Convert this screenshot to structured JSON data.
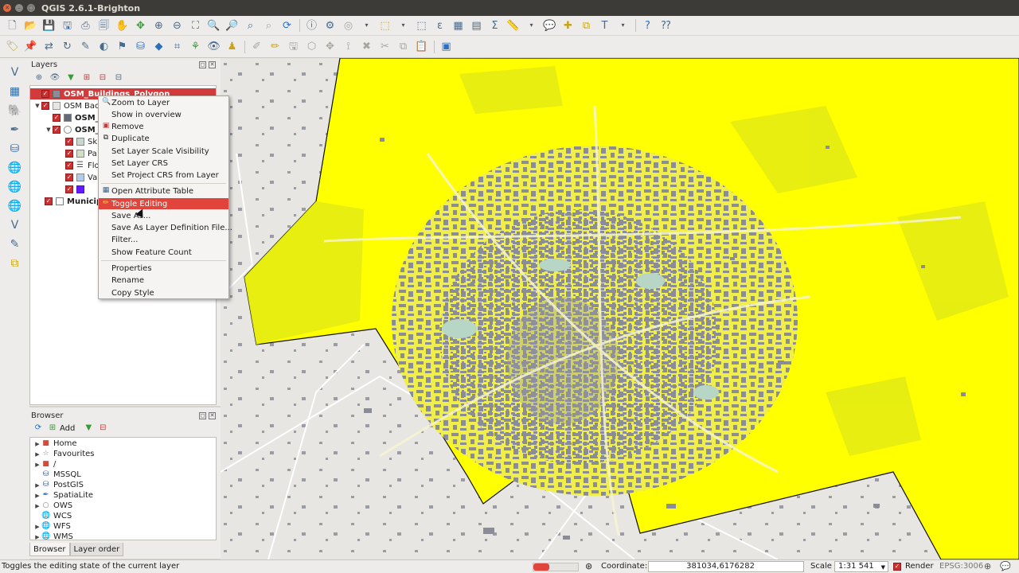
{
  "window": {
    "title": "QGIS 2.6.1-Brighton"
  },
  "toolbar_top": {
    "icons": [
      "new-project-icon",
      "open-project-icon",
      "save-project-icon",
      "save-as-icon",
      "print-composer-icon",
      "composer-manager-icon",
      "pan-icon",
      "pan-to-selection-icon",
      "zoom-in-icon",
      "zoom-out-icon",
      "zoom-full-icon",
      "zoom-to-selection-icon",
      "zoom-to-layer-icon",
      "zoom-last-icon",
      "zoom-next-icon",
      "refresh-icon",
      "identify-icon",
      "action-icon",
      "select-icon",
      "deselect-icon",
      "measure-icon",
      "field-calculator-icon",
      "attribute-table-icon",
      "statistics-icon",
      "map-tips-icon",
      "new-bookmark-icon",
      "bookmarks-icon",
      "annotation-icon",
      "text-annotation-icon",
      "help-icon",
      "whats-this-icon"
    ]
  },
  "toolbar_second": {
    "icons": [
      "label-icon",
      "pin-label-icon",
      "move-label-icon",
      "rotate-label-icon",
      "change-label-icon",
      "show-hide-labels-icon",
      "db-manager-icon",
      "georeferencer-icon",
      "csw-icon",
      "plugin-icon",
      "eye-icon",
      "python-icon",
      "edit-pencil-icon",
      "toggle-editing-icon",
      "save-edits-icon",
      "add-feature-icon",
      "move-feature-icon",
      "node-tool-icon",
      "delete-selected-icon",
      "cut-features-icon",
      "copy-features-icon",
      "paste-features-icon",
      "map-canvas-icon"
    ]
  },
  "left_toolbar": {
    "icons": [
      "add-vector-layer-icon",
      "add-raster-layer-icon",
      "add-postgis-layer-icon",
      "add-spatialite-layer-icon",
      "add-mssql-layer-icon",
      "add-wms-layer-icon",
      "add-wcs-layer-icon",
      "add-wfs-layer-icon",
      "add-delimited-text-icon",
      "new-shapefile-icon",
      "new-temp-layer-icon"
    ]
  },
  "layers_panel": {
    "title": "Layers",
    "layers": [
      {
        "label": "OSM_Buildings_Polygon",
        "checked": true,
        "selected": true
      },
      {
        "label": "OSM Bac",
        "checked": true,
        "group": true
      },
      {
        "label": "OSM_",
        "checked": true
      },
      {
        "label": "OSM_",
        "checked": true,
        "group": true
      },
      {
        "label": "Sk",
        "checked": true,
        "swatch": "#c7d9cf"
      },
      {
        "label": "Pa",
        "checked": true,
        "swatch": "#cfe0c4"
      },
      {
        "label": "Flo",
        "checked": true,
        "swatch": "#a6c5e8"
      },
      {
        "label": "Va",
        "checked": true,
        "swatch": "#b3cce9"
      },
      {
        "label": "",
        "checked": true,
        "swatch": "#6619ff"
      },
      {
        "label": "Municip",
        "checked": true,
        "unchecked_extra": true
      }
    ]
  },
  "context_menu": {
    "items": [
      {
        "label": "Zoom to Layer",
        "icon": "zoom-to-layer-icon"
      },
      {
        "label": "Show in overview",
        "icon": ""
      },
      {
        "label": "Remove",
        "icon": "remove-icon"
      },
      {
        "label": "Duplicate",
        "icon": "duplicate-icon"
      },
      {
        "label": "Set Layer Scale Visibility",
        "icon": ""
      },
      {
        "label": "Set Layer CRS",
        "icon": ""
      },
      {
        "label": "Set Project CRS from Layer",
        "icon": ""
      },
      {
        "label": "Open Attribute Table",
        "icon": "attribute-table-icon"
      },
      {
        "label": "Toggle Editing",
        "icon": "pencil-icon",
        "highlighted": true
      },
      {
        "label": "Save As...",
        "icon": ""
      },
      {
        "label": "Save As Layer Definition File...",
        "icon": ""
      },
      {
        "label": "Filter...",
        "icon": ""
      },
      {
        "label": "Show Feature Count",
        "icon": ""
      },
      {
        "label": "Properties",
        "icon": ""
      },
      {
        "label": "Rename",
        "icon": ""
      },
      {
        "label": "Copy Style",
        "icon": ""
      }
    ]
  },
  "browser_panel": {
    "title": "Browser",
    "add_label": "Add",
    "items": [
      {
        "label": "Home",
        "icon": "home-folder-icon",
        "expandable": true
      },
      {
        "label": "Favourites",
        "icon": "star-icon",
        "expandable": true
      },
      {
        "label": "/",
        "icon": "folder-icon",
        "expandable": true
      },
      {
        "label": "MSSQL",
        "icon": "mssql-icon",
        "expandable": false
      },
      {
        "label": "PostGIS",
        "icon": "postgis-icon",
        "expandable": true
      },
      {
        "label": "SpatiaLite",
        "icon": "spatialite-icon",
        "expandable": true
      },
      {
        "label": "OWS",
        "icon": "ows-icon",
        "expandable": true
      },
      {
        "label": "WCS",
        "icon": "wcs-icon",
        "expandable": false
      },
      {
        "label": "WFS",
        "icon": "wfs-icon",
        "expandable": true
      },
      {
        "label": "WMS",
        "icon": "wms-icon",
        "expandable": true
      }
    ],
    "tabs": [
      "Browser",
      "Layer order"
    ]
  },
  "status_bar": {
    "message": "Toggles the editing state of the current layer",
    "coordinate_label": "Coordinate:",
    "coordinate_value": "381034,6176282",
    "scale_label": "Scale",
    "scale_value": "1:31 541",
    "render_label": "Render",
    "render_checked": true,
    "crs_label": "EPSG:3006"
  },
  "colors": {
    "selection_red": "#d23b3b",
    "menu_highlight": "#e0443a",
    "municipality_fill": "#ffff00",
    "buildings": "#8a8d97"
  }
}
